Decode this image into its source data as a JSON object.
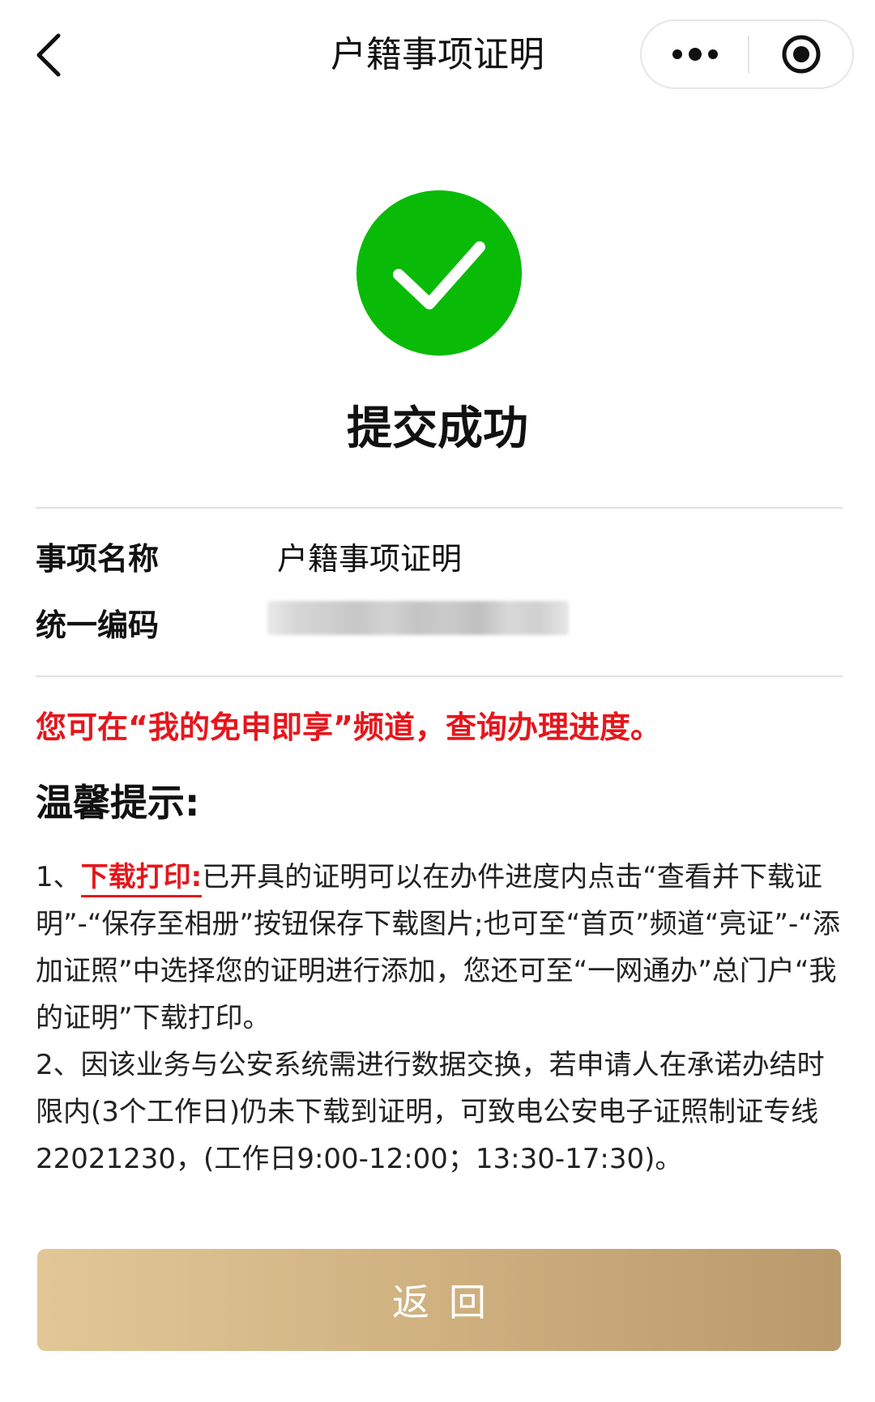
{
  "nav": {
    "title": "户籍事项证明"
  },
  "result": {
    "title": "提交成功",
    "icon_color": "#09bb07"
  },
  "info": {
    "name_label": "事项名称",
    "name_value": "户籍事项证明",
    "code_label": "统一编码"
  },
  "notice": {
    "text": "您可在“我的免申即享”频道，查询办理进度。",
    "color": "#e6161c"
  },
  "tips": {
    "heading": "温馨提示:",
    "item1_prefix": "1、",
    "item1_highlight": "下载打印:",
    "item1_text": "已开具的证明可以在办件进度内点击“查看并下载证明”-“保存至相册”按钮保存下载图片;也可至“首页”频道“亮证”-“添加证照”中选择您的证明进行添加，您还可至“一网通办”总门户“我的证明”下载打印。",
    "item2_text": "2、因该业务与公安系统需进行数据交换，若申请人在承诺办结时限内(3个工作日)仍未下载到证明，可致电公安电子证照制证专线22021230，(工作日9:00-12:00；13:30-17:30)。"
  },
  "return_button": {
    "label": "返回"
  }
}
